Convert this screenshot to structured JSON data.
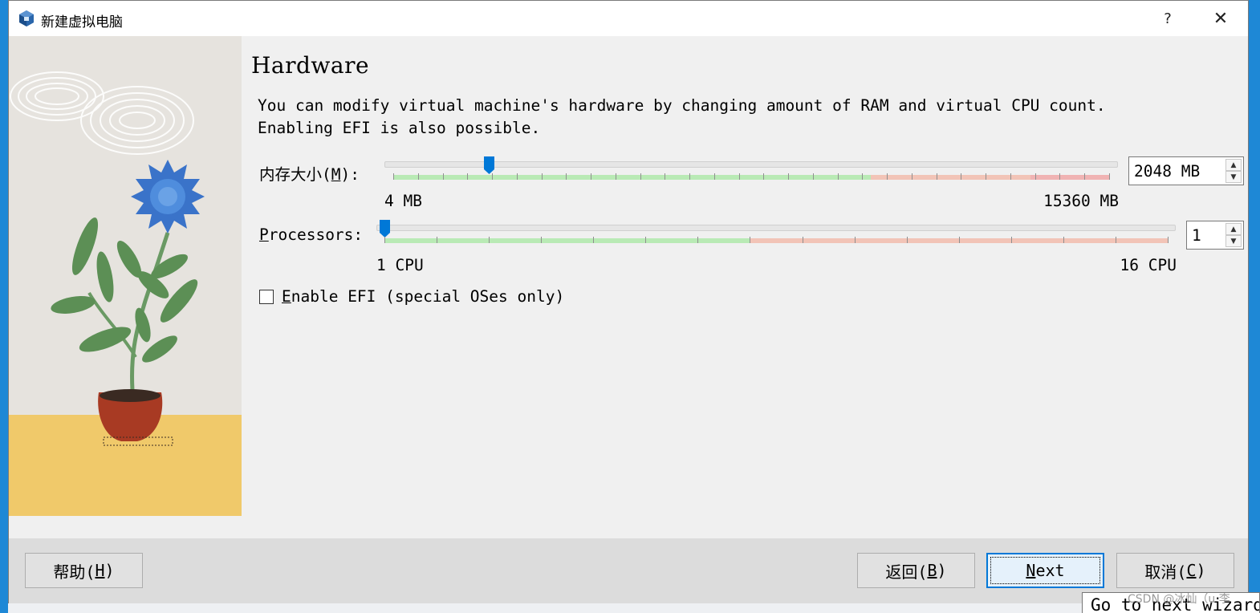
{
  "window": {
    "title": "新建虚拟电脑",
    "help_label": "?",
    "close_label": "✕"
  },
  "page": {
    "title": "Hardware",
    "description_line1": "You can modify virtual machine's hardware by changing amount of RAM and virtual CPU count.",
    "description_line2": "Enabling EFI is also possible."
  },
  "memory": {
    "label_prefix": "内存大小(",
    "label_key": "M",
    "label_suffix": "):",
    "value": "2048 MB",
    "min_label": "4 MB",
    "max_label": "15360 MB",
    "min": 4,
    "max": 15360,
    "current": 2048,
    "recommended_max": 10240
  },
  "processors": {
    "label_key": "P",
    "label_rest": "rocessors:",
    "value": "1",
    "min_label": "1 CPU",
    "max_label": "16 CPU",
    "min": 1,
    "max": 16,
    "current": 1,
    "recommended_max": 8
  },
  "efi": {
    "label_key": "E",
    "label_rest": "nable EFI (special OSes only)",
    "checked": false
  },
  "buttons": {
    "help_prefix": "帮助(",
    "help_key": "H",
    "help_suffix": ")",
    "back_prefix": "返回(",
    "back_key": "B",
    "back_suffix": ")",
    "next_key": "N",
    "next_rest": "ext",
    "cancel_prefix": "取消(",
    "cancel_key": "C",
    "cancel_suffix": ")"
  },
  "tooltip": "Go to next wizard page",
  "watermark": "CSDN @冰灿（u 李",
  "colors": {
    "accent": "#0078d7",
    "safe_range": "#b9eab5",
    "warn_range": "#f2c4b7",
    "danger_range": "#f0b3b3"
  }
}
